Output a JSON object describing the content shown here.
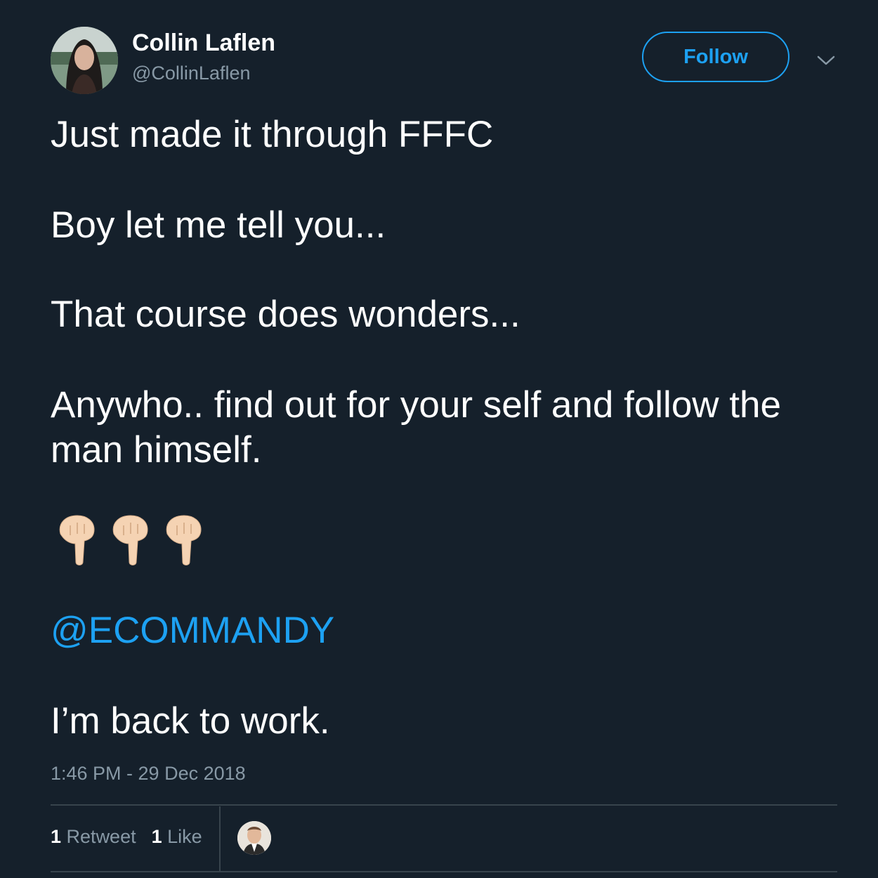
{
  "header": {
    "display_name": "Collin Laflen",
    "handle": "@CollinLaflen",
    "follow_label": "Follow"
  },
  "tweet": {
    "line1": "Just made it through FFFC",
    "line2": "Boy let me tell you...",
    "line3": "That course does wonders...",
    "line4a": "Anywho.. find out for your self and follow the",
    "line4b": "man himself.",
    "emojis": [
      "pointing-down-hand-light-skin",
      "pointing-down-hand-light-skin",
      "pointing-down-hand-light-skin"
    ],
    "mention": "@ECOMMANDY",
    "line5": "I’m back to work."
  },
  "meta": {
    "timestamp": "1:46 PM - 29 Dec 2018"
  },
  "stats": {
    "retweets_count": "1",
    "retweets_label": "Retweet",
    "likes_count": "1",
    "likes_label": "Like"
  },
  "colors": {
    "background": "#15202b",
    "accent": "#1da1f2",
    "secondary_text": "#8899a6",
    "divider": "#38444d"
  }
}
